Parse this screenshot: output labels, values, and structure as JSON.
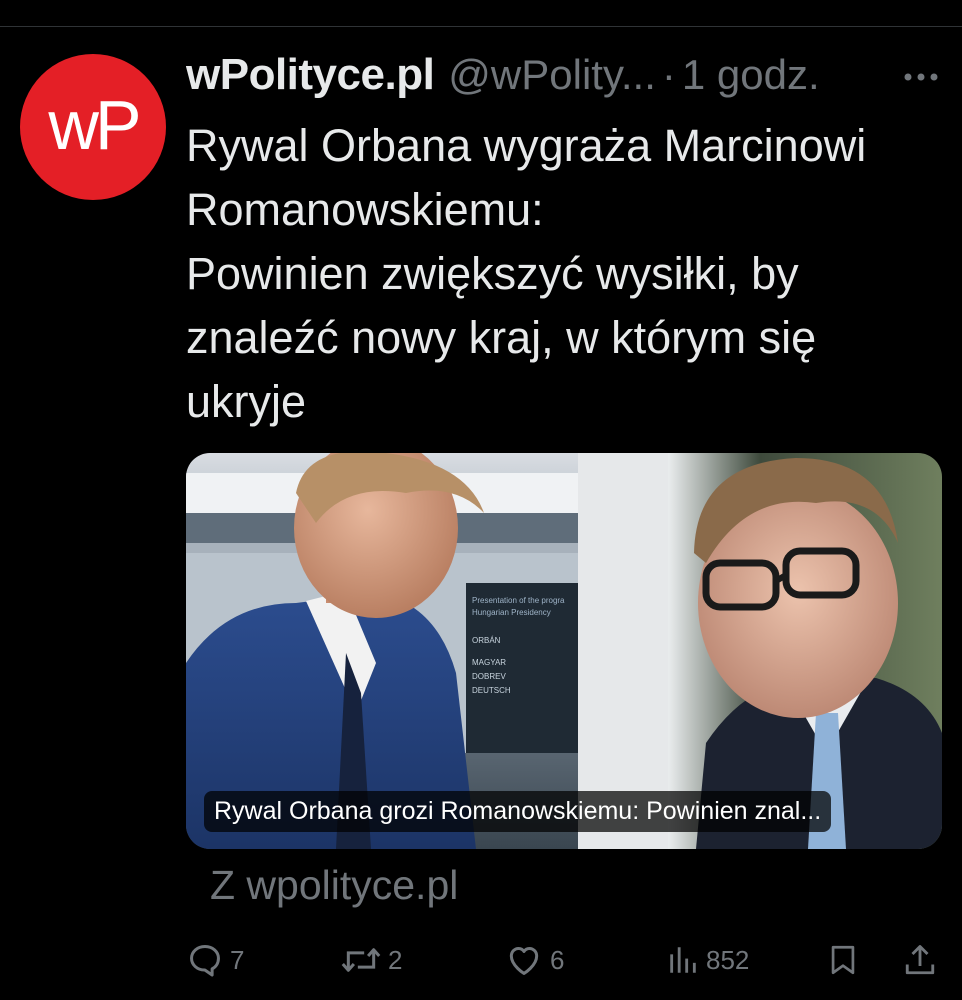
{
  "post": {
    "avatar_text": "wP",
    "display_name": "wPolityce.pl",
    "handle": "@wPolity...",
    "separator": "·",
    "time": "1 godz.",
    "text": "Rywal Orbana wygraża Marcinowi\nRomanowskiemu:\nPowinien zwiększyć wysiłki, by\nznaleźć nowy kraj, w którym się\nukryje"
  },
  "card": {
    "caption": "Rywal Orbana grozi Romanowskiemu: Powinien znal...",
    "screen_lines": [
      "Presentation of the progra",
      "Hungarian Presidency",
      "ORBÁN",
      "MAGYAR",
      "DOBREV",
      "DEUTSCH"
    ]
  },
  "source": {
    "label": "Z wpolityce.pl"
  },
  "actions": {
    "replies": "7",
    "reposts": "2",
    "likes": "6",
    "views": "852"
  },
  "icons": {
    "more": "more-dots-icon",
    "reply": "reply-bubble-icon",
    "repost": "repost-arrows-icon",
    "like": "heart-icon",
    "views": "bar-chart-icon",
    "bookmark": "bookmark-icon",
    "share": "share-upload-icon"
  },
  "colors": {
    "background": "#000000",
    "text_primary": "#e7e9ea",
    "text_secondary": "#71767b",
    "avatar_brand": "#e41f26",
    "divider": "#2f3336"
  }
}
